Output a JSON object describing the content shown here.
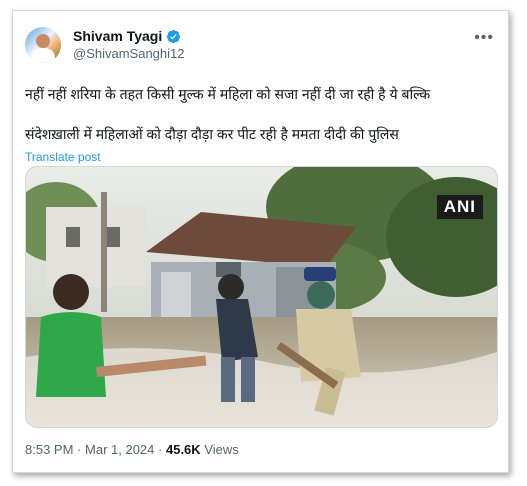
{
  "tweet": {
    "author_name": "Shivam Tyagi",
    "author_handle": "@ShivamSanghi12",
    "verified": true,
    "text_line_1": "नहीं नहीं शरिया के तहत किसी मुल्क में महिला को सजा नहीं दी जा रही है ये बल्कि",
    "text_line_2": "संदेशख़ाली में महिलाओं को दौड़ा दौड़ा कर पीट रही है ममता दीदी की पुलिस",
    "translate_label": "Translate post",
    "media_watermark": "ANI",
    "time": "8:53 PM",
    "date": "Mar 1, 2024",
    "separator": "·",
    "views_count": "45.6K",
    "views_label": "Views"
  },
  "colors": {
    "link": "#1d9bf0",
    "secondary_text": "#536471",
    "border": "#cfd9de"
  },
  "icons": {
    "verified": "verified-badge-icon",
    "more": "more-options-icon"
  }
}
